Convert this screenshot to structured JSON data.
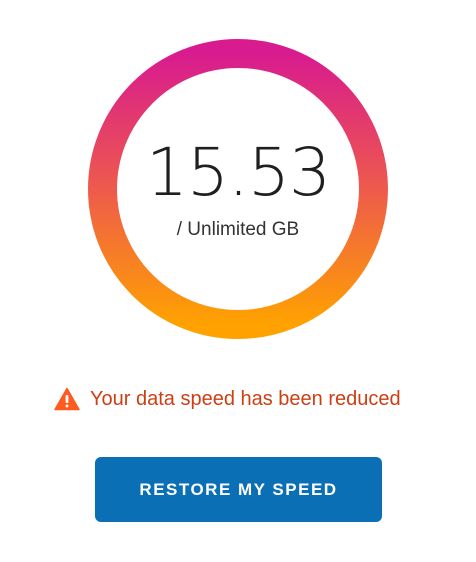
{
  "usage": {
    "value": "15.53",
    "limit_label": "/ Unlimited GB"
  },
  "gauge": {
    "gradient_top_color": "#d81b8f",
    "gradient_bottom_color": "#ffa200"
  },
  "alert": {
    "icon": "warning-triangle-icon",
    "message": "Your data speed has been reduced",
    "color": "#cc3f14"
  },
  "actions": {
    "restore_label": "RESTORE MY SPEED",
    "button_color": "#0b6fb5"
  }
}
